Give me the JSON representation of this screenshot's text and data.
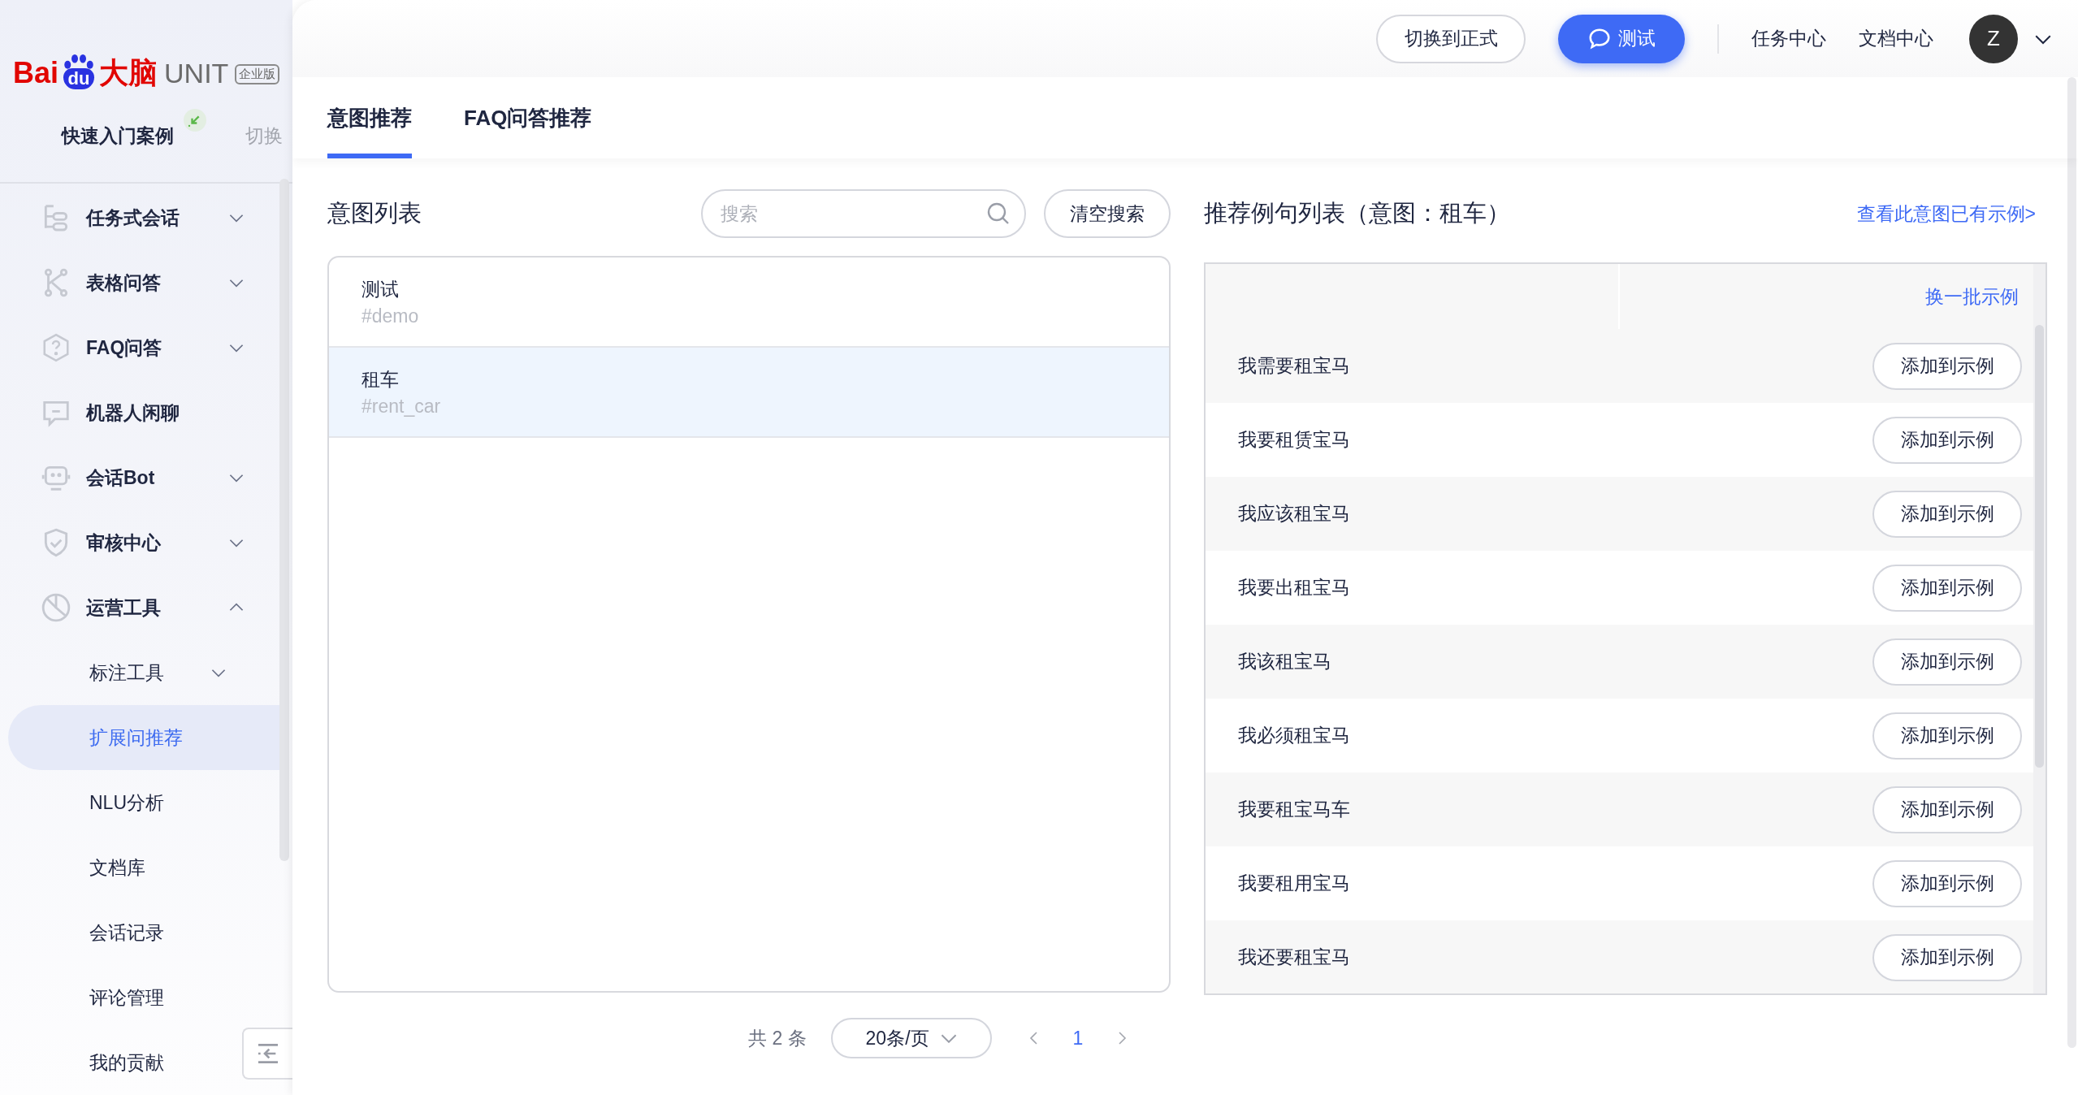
{
  "logo": {
    "brand": "Bai",
    "mark": "du",
    "brand_suffix": "大脑",
    "product": "UNIT",
    "edition": "企业版"
  },
  "quick_start": {
    "label": "快速入门案例",
    "action": "切换"
  },
  "sidebar": {
    "items": [
      {
        "label": "任务式会话",
        "expanded": false
      },
      {
        "label": "表格问答",
        "expanded": false
      },
      {
        "label": "FAQ问答",
        "expanded": false
      },
      {
        "label": "机器人闲聊"
      },
      {
        "label": "会话Bot",
        "expanded": false
      },
      {
        "label": "审核中心",
        "expanded": false
      },
      {
        "label": "运营工具",
        "expanded": true,
        "children": [
          {
            "label": "标注工具",
            "expanded": false,
            "selected": false
          },
          {
            "label": "扩展问推荐",
            "selected": true
          },
          {
            "label": "NLU分析",
            "selected": false
          },
          {
            "label": "文档库",
            "selected": false
          },
          {
            "label": "会话记录",
            "selected": false
          },
          {
            "label": "评论管理",
            "selected": false
          },
          {
            "label": "我的贡献",
            "selected": false
          }
        ]
      }
    ]
  },
  "topbar": {
    "switch_button": "切换到正式",
    "test_button": "测试",
    "links": [
      "任务中心",
      "文档中心"
    ],
    "avatar": "Z"
  },
  "tabs": [
    {
      "label": "意图推荐",
      "selected": true
    },
    {
      "label": "FAQ问答推荐",
      "selected": false
    }
  ],
  "intent_list": {
    "title": "意图列表",
    "search": {
      "placeholder": "搜索"
    },
    "clear_button": "清空搜索",
    "items": [
      {
        "name": "测试",
        "id": "#demo",
        "selected": false
      },
      {
        "name": "租车",
        "id": "#rent_car",
        "selected": true
      }
    ],
    "pagination": {
      "total": "共 2 条",
      "page_size": "20条/页",
      "pages": [
        {
          "label": "1",
          "selected": true
        }
      ]
    }
  },
  "examples": {
    "title": "推荐例句列表（意图：租车）",
    "view_link": "查看此意图已有示例>",
    "refresh_link": "换一批示例",
    "rows": [
      {
        "text": "我需要租宝马",
        "action": "添加到示例"
      },
      {
        "text": "我要租赁宝马",
        "action": "添加到示例"
      },
      {
        "text": "我应该租宝马",
        "action": "添加到示例"
      },
      {
        "text": "我要出租宝马",
        "action": "添加到示例"
      },
      {
        "text": "我该租宝马",
        "action": "添加到示例"
      },
      {
        "text": "我必须租宝马",
        "action": "添加到示例"
      },
      {
        "text": "我要租宝马车",
        "action": "添加到示例"
      },
      {
        "text": "我要租用宝马",
        "action": "添加到示例"
      },
      {
        "text": "我还要租宝马",
        "action": "添加到示例"
      }
    ]
  }
}
